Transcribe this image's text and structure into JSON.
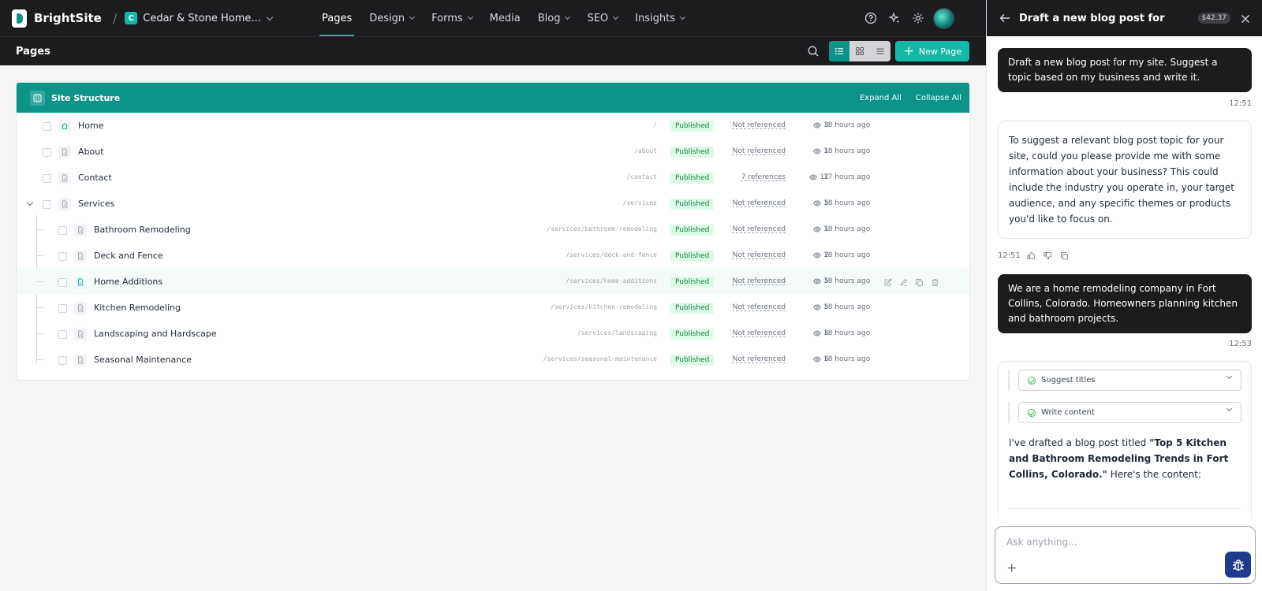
{
  "app": {
    "brand": "BrightSite",
    "site_initial": "C",
    "site_name": "Cedar & Stone Home..."
  },
  "nav": {
    "items": [
      {
        "label": "Pages",
        "active": true,
        "dropdown": false
      },
      {
        "label": "Design",
        "active": false,
        "dropdown": true
      },
      {
        "label": "Forms",
        "active": false,
        "dropdown": true
      },
      {
        "label": "Media",
        "active": false,
        "dropdown": false
      },
      {
        "label": "Blog",
        "active": false,
        "dropdown": true
      },
      {
        "label": "SEO",
        "active": false,
        "dropdown": true
      },
      {
        "label": "Insights",
        "active": false,
        "dropdown": true
      }
    ],
    "icons": [
      "help-icon",
      "sparkle-icon",
      "gear-icon",
      "avatar"
    ]
  },
  "subheader": {
    "title": "Pages",
    "new_page_label": "New Page",
    "views": [
      "list-view",
      "grid-view",
      "compact-view"
    ]
  },
  "structure": {
    "title": "Site Structure",
    "expand_all": "Expand All",
    "collapse_all": "Collapse All",
    "pages": [
      {
        "name": "Home",
        "slug": "/",
        "status": "Published",
        "refs": "Not referenced",
        "views": "3",
        "updated": "18 hours ago",
        "level": 0,
        "icon": "home-icon"
      },
      {
        "name": "About",
        "slug": "/about",
        "status": "Published",
        "refs": "Not referenced",
        "views": "1",
        "updated": "18 hours ago",
        "level": 0,
        "icon": "page-icon"
      },
      {
        "name": "Contact",
        "slug": "/contact",
        "status": "Published",
        "refs": "7 references",
        "views": "12",
        "updated": "17 hours ago",
        "level": 0,
        "icon": "page-icon"
      },
      {
        "name": "Services",
        "slug": "/services",
        "status": "Published",
        "refs": "Not referenced",
        "views": "5",
        "updated": "18 hours ago",
        "level": 0,
        "icon": "page-icon"
      },
      {
        "name": "Bathroom Remodeling",
        "slug": "/services/bathroom-remodeling",
        "status": "Published",
        "refs": "Not referenced",
        "views": "1",
        "updated": "18 hours ago",
        "level": 1,
        "icon": "page-icon"
      },
      {
        "name": "Deck and Fence",
        "slug": "/services/deck-and-fence",
        "status": "Published",
        "refs": "Not referenced",
        "views": "2",
        "updated": "18 hours ago",
        "level": 1,
        "icon": "page-icon"
      },
      {
        "name": "Home Additions",
        "slug": "/services/home-additions",
        "status": "Published",
        "refs": "Not referenced",
        "views": "5",
        "updated": "18 hours ago",
        "level": 1,
        "icon": "page-icon"
      },
      {
        "name": "Kitchen Remodeling",
        "slug": "/services/kitchen-remodeling",
        "status": "Published",
        "refs": "Not referenced",
        "views": "5",
        "updated": "18 hours ago",
        "level": 1,
        "icon": "page-icon"
      },
      {
        "name": "Landscaping and Hardscape",
        "slug": "/services/landscaping",
        "status": "Published",
        "refs": "Not referenced",
        "views": "6",
        "updated": "18 hours ago",
        "level": 1,
        "icon": "page-icon"
      },
      {
        "name": "Seasonal Maintenance",
        "slug": "/services/seasonal-maintenance",
        "status": "Published",
        "refs": "Not referenced",
        "views": "6",
        "updated": "18 hours ago",
        "level": 1,
        "icon": "page-icon"
      }
    ],
    "row_actions": [
      "edit-icon",
      "edit-content-icon",
      "duplicate-icon",
      "trash-icon"
    ]
  },
  "chat": {
    "title": "Draft a new blog post for",
    "cost": "$42.37",
    "messages": {
      "user1": "Draft a new blog post for my site. Suggest a topic based on my business and write it.",
      "user1_time": "12:51",
      "ai1": "To suggest a relevant blog post topic for your site, could you please provide me with some information about your business? This could include the industry you operate in, your target audience, and any specific themes or products you'd like to focus on.",
      "ai1_time": "12:51",
      "user2": "We are a home remodeling company in Fort Collins, Colorado. Homeowners planning kitchen and bathroom projects.",
      "user2_time": "12:53",
      "step1": "Suggest titles",
      "step2": "Write content",
      "ai2_pre": "I've drafted a blog post titled ",
      "ai2_title": "\"Top 5 Kitchen and Bathroom Remodeling Trends in Fort Collins, Colorado.\"",
      "ai2_post": " Here's the content:"
    },
    "composer_placeholder": "Ask anything..."
  },
  "colors": {
    "accent": "#14b8a6",
    "accent_dark": "#0d9488",
    "nav_bg": "#1c1c1e",
    "status_bg": "#dcfce7",
    "status_text": "#15803d",
    "send_btn": "#1e3a8a"
  }
}
